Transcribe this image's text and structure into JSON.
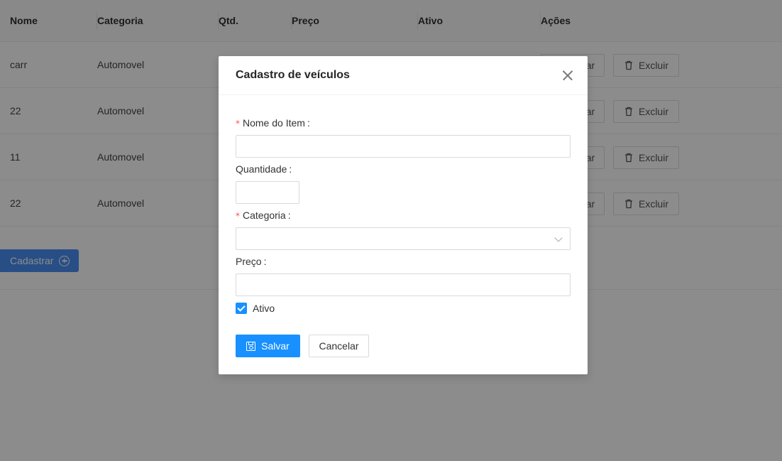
{
  "table": {
    "headers": {
      "nome": "Nome",
      "categoria": "Categoria",
      "qtd": "Qtd.",
      "preco": "Preço",
      "ativo": "Ativo",
      "acoes": "Ações"
    },
    "rows": [
      {
        "nome": "carr",
        "categoria": "Automovel",
        "edit_label": "ar",
        "delete_label": "Excluir"
      },
      {
        "nome": "22",
        "categoria": "Automovel",
        "edit_label": "ar",
        "delete_label": "Excluir"
      },
      {
        "nome": "11",
        "categoria": "Automovel",
        "edit_label": "ar",
        "delete_label": "Excluir"
      },
      {
        "nome": "22",
        "categoria": "Automovel",
        "edit_label": "ar",
        "delete_label": "Excluir"
      }
    ]
  },
  "page": {
    "cadastrar_label": "Cadastrar"
  },
  "modal": {
    "title": "Cadastro de veículos",
    "fields": {
      "nome_label": "Nome do Item",
      "nome_value": "",
      "quantidade_label": "Quantidade",
      "quantidade_value": "",
      "categoria_label": "Categoria",
      "categoria_value": "",
      "preco_label": "Preço",
      "preco_value": "",
      "ativo_label": "Ativo",
      "ativo_checked": true
    },
    "required_mark": "*",
    "colon": ":",
    "save_label": "Salvar",
    "cancel_label": "Cancelar"
  },
  "colors": {
    "primary": "#1890ff",
    "required": "#ff4d4f"
  }
}
